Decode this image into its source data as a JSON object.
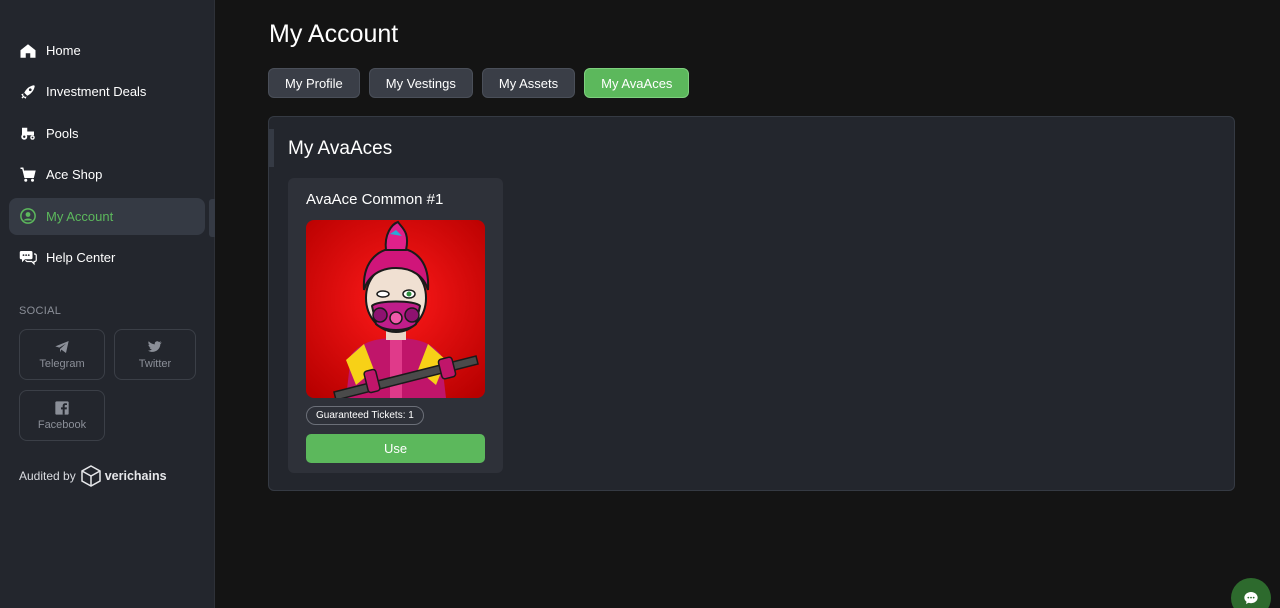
{
  "sidebar": {
    "nav": [
      {
        "label": "Home",
        "icon": "home-icon"
      },
      {
        "label": "Investment Deals",
        "icon": "rocket-icon"
      },
      {
        "label": "Pools",
        "icon": "tractor-icon"
      },
      {
        "label": "Ace Shop",
        "icon": "cart-icon"
      },
      {
        "label": "My Account",
        "icon": "user-circle-icon",
        "active": true
      },
      {
        "label": "Help Center",
        "icon": "chat-bubbles-icon"
      }
    ],
    "social_heading": "SOCIAL",
    "social": [
      {
        "label": "Telegram",
        "icon": "telegram-icon"
      },
      {
        "label": "Twitter",
        "icon": "twitter-icon"
      },
      {
        "label": "Facebook",
        "icon": "facebook-icon"
      }
    ],
    "audited_label": "Audited by",
    "auditor": "verichains"
  },
  "main": {
    "title": "My Account",
    "tabs": [
      {
        "label": "My Profile"
      },
      {
        "label": "My Vestings"
      },
      {
        "label": "My Assets"
      },
      {
        "label": "My AvaAces",
        "active": true
      }
    ],
    "panel_title": "My AvaAces",
    "card": {
      "title": "AvaAce Common #1",
      "badge": "Guaranteed Tickets: 1",
      "button": "Use"
    }
  },
  "colors": {
    "accent_green": "#5cb85c",
    "sidebar_bg": "#23262d",
    "page_bg": "#141414"
  }
}
